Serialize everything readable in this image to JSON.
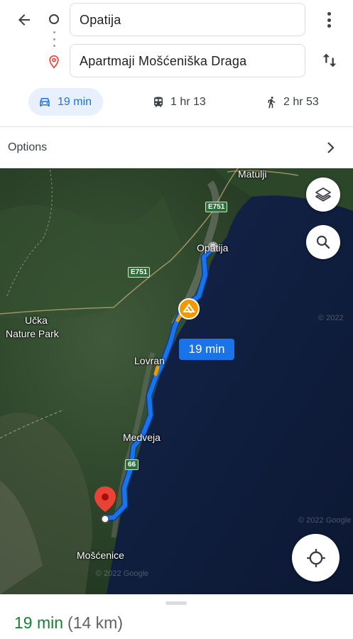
{
  "route": {
    "origin": "Opatija",
    "destination": "Apartmaji Mošćeniška Draga"
  },
  "modes": [
    {
      "name": "drive",
      "label": "19 min",
      "icon": "car-icon",
      "selected": true
    },
    {
      "name": "transit",
      "label": "1 hr 13",
      "icon": "train-icon",
      "selected": false
    },
    {
      "name": "walk",
      "label": "2 hr 53",
      "icon": "walk-icon",
      "selected": false
    }
  ],
  "options": {
    "label": "Options"
  },
  "map": {
    "places": {
      "matulji": "Matulji",
      "opatija": "Opatija",
      "ucka_line1": "Učka",
      "ucka_line2": "Nature Park",
      "lovran": "Lovran",
      "medveja": "Medveja",
      "moscenice": "Mošćenice"
    },
    "road_labels": {
      "e751_top": "E751",
      "e751_mid": "E751",
      "route66": "66"
    },
    "route_time": "19 min",
    "watermarks": {
      "w1": "© 2022",
      "w2": "© 2022 Google",
      "w3": "© 2022 Google"
    },
    "colors": {
      "route": "#1a73e8",
      "destination_pin": "#ea4335",
      "incident": "#f29900"
    }
  },
  "summary": {
    "duration": "19 min",
    "distance": "(14 km)"
  }
}
